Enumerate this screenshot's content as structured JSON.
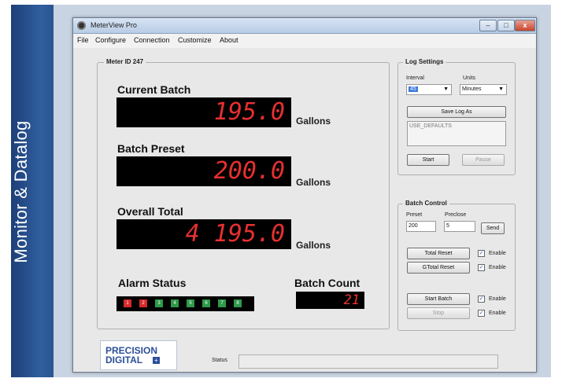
{
  "sidebar_title": "Monitor & Datalog",
  "window": {
    "title": "MeterView Pro",
    "min": "–",
    "max": "□",
    "close": "x"
  },
  "menu": [
    "File",
    "Configure",
    "Connection",
    "Customize",
    "About"
  ],
  "meter": {
    "group_label": "Meter ID 247",
    "current_batch": {
      "label": "Current Batch",
      "value": "195.0",
      "unit": "Gallons"
    },
    "batch_preset": {
      "label": "Batch Preset",
      "value": "200.0",
      "unit": "Gallons"
    },
    "overall_total": {
      "label": "Overall Total",
      "value": "4 195.0",
      "unit": "Gallons"
    },
    "alarm_status": {
      "label": "Alarm Status",
      "leds": [
        "1",
        "2",
        "3",
        "4",
        "5",
        "6",
        "7",
        "8"
      ],
      "active_color": "#d62b2b",
      "inactive_color": "#2e9a4a",
      "active": [
        true,
        true,
        false,
        false,
        false,
        false,
        false,
        false
      ]
    },
    "batch_count": {
      "label": "Batch Count",
      "value": "21"
    }
  },
  "log_settings": {
    "group_label": "Log Settings",
    "interval_label": "Interval",
    "interval_value": "45",
    "units_label": "Units",
    "units_value": "Minutes",
    "save_button": "Save Log As",
    "path_value": "USE_DEFAULTS",
    "start_button": "Start",
    "pause_button": "Pause"
  },
  "batch_control": {
    "group_label": "Batch Control",
    "preset_label": "Preset",
    "preset_value": "200",
    "preclose_label": "Preclose",
    "preclose_value": "5",
    "send_button": "Send",
    "total_reset_button": "Total Reset",
    "gtotal_reset_button": "GTotal Reset",
    "start_batch_button": "Start Batch",
    "stop_button": "Stop",
    "enable_label": "Enable",
    "check_mark": "✓"
  },
  "logo": {
    "line1": "PRECISION",
    "line2": "DIGITAL"
  },
  "status_label": "Status"
}
